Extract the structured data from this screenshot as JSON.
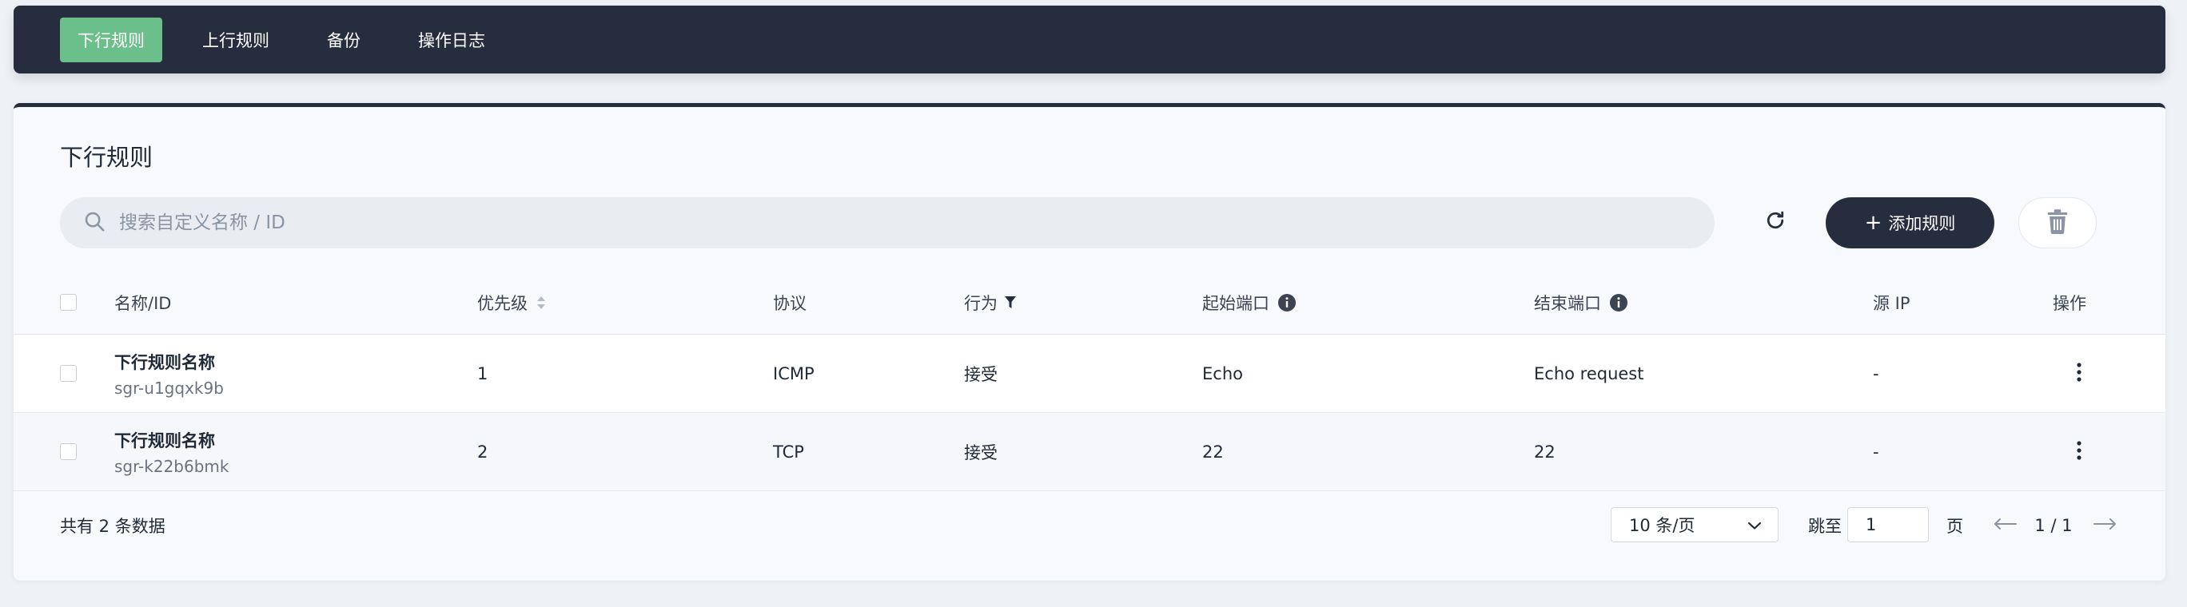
{
  "nav": {
    "tabs": [
      {
        "label": "下行规则",
        "active": true
      },
      {
        "label": "上行规则",
        "active": false
      },
      {
        "label": "备份",
        "active": false
      },
      {
        "label": "操作日志",
        "active": false
      }
    ]
  },
  "main": {
    "title": "下行规则",
    "search_placeholder": "搜索自定义名称 / ID",
    "add_button": "添加规则"
  },
  "table": {
    "headers": {
      "name": "名称/ID",
      "priority": "优先级",
      "protocol": "协议",
      "action": "行为",
      "start_port": "起始端口",
      "end_port": "结束端口",
      "source_ip": "源 IP",
      "operation": "操作"
    },
    "rows": [
      {
        "name": "下行规则名称",
        "id": "sgr-u1gqxk9b",
        "priority": "1",
        "protocol": "ICMP",
        "action": "接受",
        "start_port": "Echo",
        "end_port": "Echo request",
        "source_ip": "-"
      },
      {
        "name": "下行规则名称",
        "id": "sgr-k22b6bmk",
        "priority": "2",
        "protocol": "TCP",
        "action": "接受",
        "start_port": "22",
        "end_port": "22",
        "source_ip": "-"
      }
    ]
  },
  "footer": {
    "total": "共有 2 条数据",
    "page_size": "10 条/页",
    "jump_label": "跳至",
    "jump_value": "1",
    "page_label": "页",
    "page_indicator": "1 / 1"
  },
  "colors": {
    "nav_bg": "#262d3f",
    "active_tab": "#6bbf8a",
    "primary_button": "#262d3f"
  }
}
